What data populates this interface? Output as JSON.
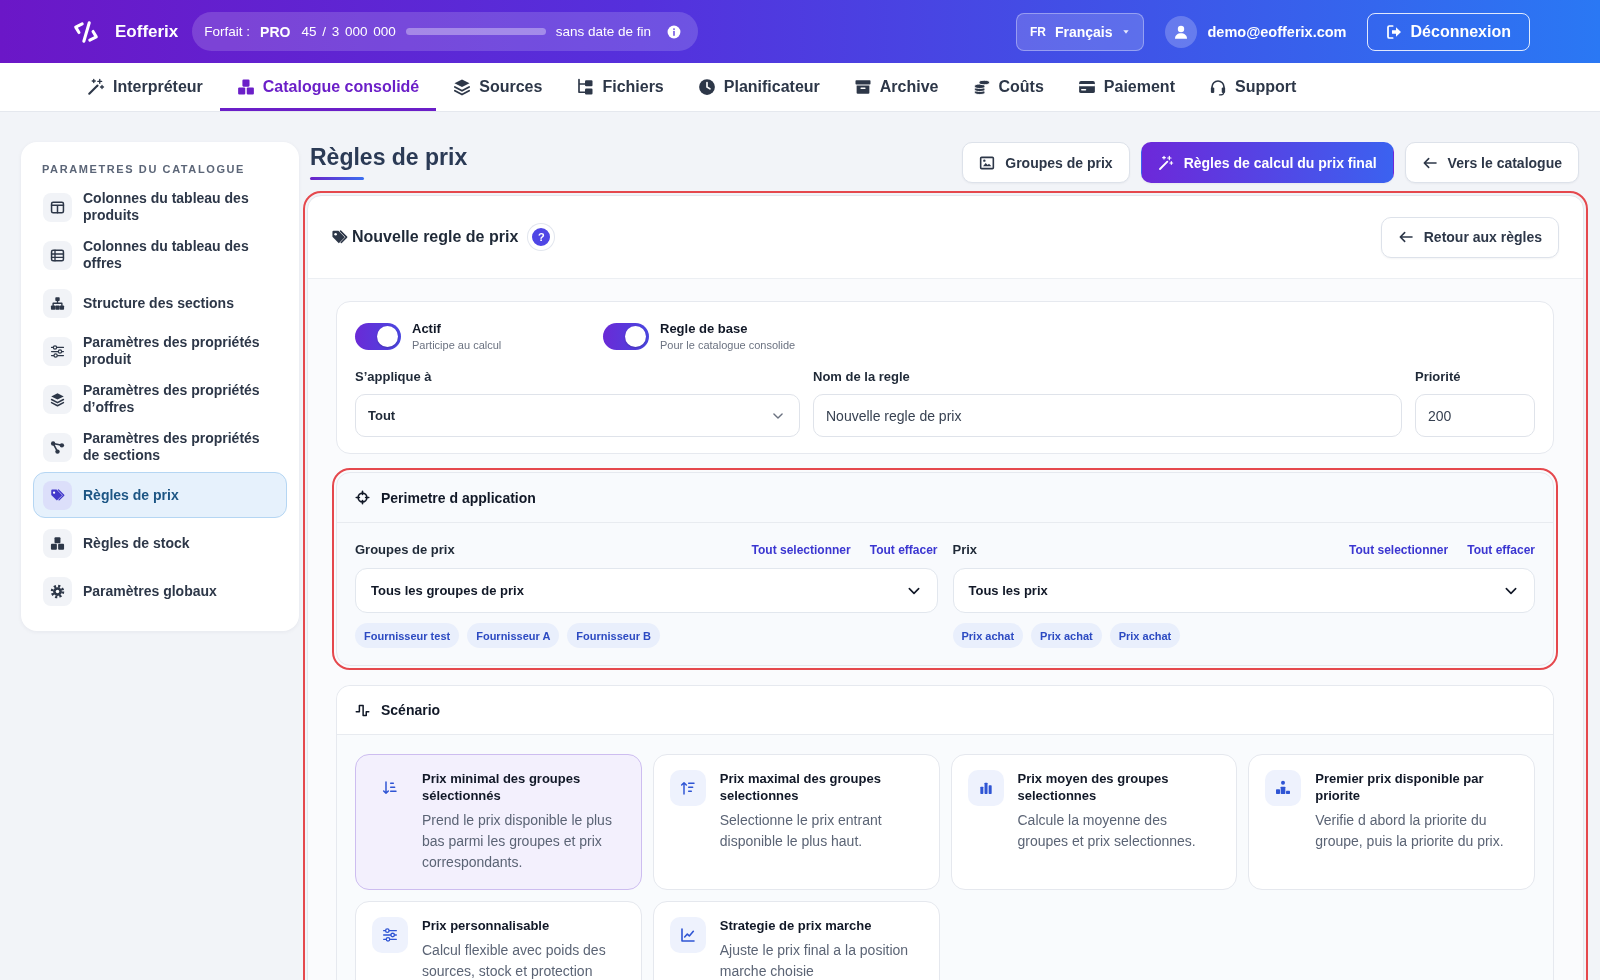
{
  "top_bar": {
    "brand": "Eofferix",
    "plan": {
      "label": "Forfait :",
      "name": "PRO",
      "usage": "45 / 3 000 000",
      "level": 0,
      "expiry": "sans date de fin"
    },
    "language": {
      "code": "FR",
      "name": "Français"
    },
    "user": {
      "email": "demo@eofferix.com"
    },
    "logout": "Déconnexion"
  },
  "nav": {
    "tabs": [
      {
        "label": "Interpréteur",
        "selected": false
      },
      {
        "label": "Catalogue consolidé",
        "selected": true
      },
      {
        "label": "Sources",
        "selected": false
      },
      {
        "label": "Fichiers",
        "selected": false
      },
      {
        "label": "Planificateur",
        "selected": false
      },
      {
        "label": "Archive",
        "selected": false
      },
      {
        "label": "Coûts",
        "selected": false
      },
      {
        "label": "Paiement",
        "selected": false
      },
      {
        "label": "Support",
        "selected": false
      }
    ]
  },
  "sidebar": {
    "heading": "PARAMETRES DU CATALOGUE",
    "items": [
      {
        "label": "Colonnes du tableau des produits",
        "selected": false
      },
      {
        "label": "Colonnes du tableau des offres",
        "selected": false
      },
      {
        "label": "Structure des sections",
        "selected": false
      },
      {
        "label": "Paramètres des propriétés produit",
        "selected": false
      },
      {
        "label": "Paramètres des propriétés d’offres",
        "selected": false
      },
      {
        "label": "Paramètres des propriétés de sections",
        "selected": false
      },
      {
        "label": "Règles de prix",
        "selected": true
      },
      {
        "label": "Règles de stock",
        "selected": false
      },
      {
        "label": "Paramètres globaux",
        "selected": false
      }
    ]
  },
  "page": {
    "title": "Règles de prix",
    "actions": [
      {
        "label": "Groupes de prix",
        "selected": false
      },
      {
        "label": "Règles de calcul du prix final",
        "selected": true
      },
      {
        "label": "Vers le catalogue",
        "selected": false
      }
    ]
  },
  "rule_editor": {
    "title": "Nouvelle regle de prix",
    "help": "?",
    "back": "Retour aux règles",
    "toggles": [
      {
        "label": "Actif",
        "hint": "Participe au calcul",
        "on": true
      },
      {
        "label": "Regle de base",
        "hint": "Pour le catalogue consolide",
        "on": true
      }
    ],
    "fields": [
      {
        "kind": "select",
        "label": "S’applique à",
        "value": "Tout"
      },
      {
        "kind": "text",
        "label": "Nom de la regle",
        "value": "Nouvelle regle de prix"
      },
      {
        "kind": "text",
        "label": "Priorité",
        "value": "200"
      }
    ],
    "scope": {
      "title": "Perimetre d application",
      "selectors": [
        {
          "label": "Groupes de prix",
          "select_all": "Tout selectionner",
          "clear": "Tout effacer",
          "value": "Tous les groupes de prix",
          "tags": [
            "Fournisseur test",
            "Fournisseur A",
            "Fournisseur B"
          ]
        },
        {
          "label": "Prix",
          "select_all": "Tout selectionner",
          "clear": "Tout effacer",
          "value": "Tous les prix",
          "tags": [
            "Prix achat",
            "Prix achat",
            "Prix achat"
          ]
        }
      ]
    },
    "scenario": {
      "title": "Scénario",
      "options": [
        {
          "title": "Prix minimal des groupes sélectionnés",
          "description": "Prend le prix disponible le plus bas parmi les groupes et prix correspondants.",
          "selected": true
        },
        {
          "title": "Prix maximal des groupes selectionnes",
          "description": "Selectionne le prix entrant disponible le plus haut.",
          "selected": false
        },
        {
          "title": "Prix moyen des groupes selectionnes",
          "description": "Calcule la moyenne des groupes et prix selectionnes.",
          "selected": false
        },
        {
          "title": "Premier prix disponible par priorite",
          "description": "Verifie d abord la priorite du groupe, puis la priorite du prix.",
          "selected": false
        },
        {
          "title": "Prix personnalisable",
          "description": "Calcul flexible avec poids des sources, stock et protection",
          "selected": false
        },
        {
          "title": "Strategie de prix marche",
          "description": "Ajuste le prix final a la position marche choisie",
          "selected": false
        }
      ]
    }
  }
}
